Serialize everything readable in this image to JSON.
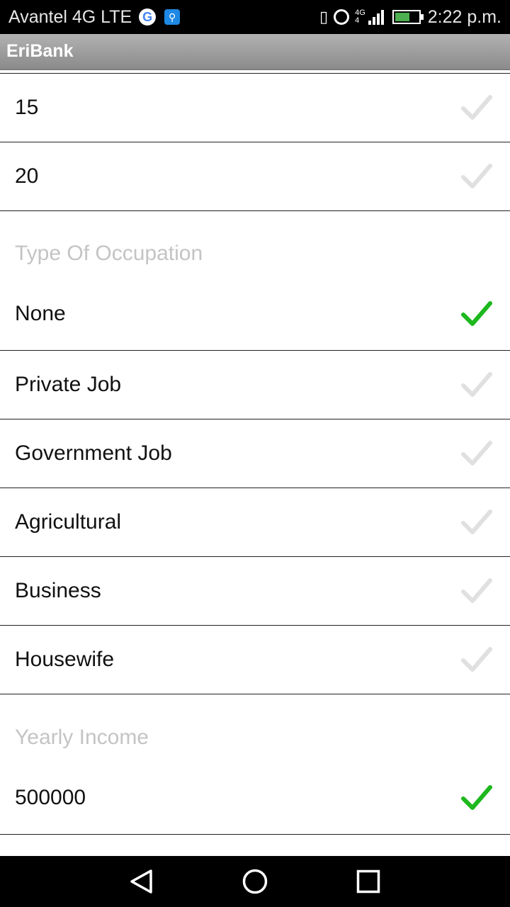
{
  "status_bar": {
    "carrier": "Avantel 4G LTE",
    "network_label_top": "4G",
    "network_label_bottom": "4",
    "time": "2:22 p.m.",
    "battery_level": 0.62
  },
  "app_bar": {
    "title": "EriBank"
  },
  "colors": {
    "check_selected": "#1db81d",
    "check_unselected": "#e0e0e0",
    "section_header": "#c4c4c4"
  },
  "lists": {
    "top_rows": [
      {
        "label": "15",
        "selected": false
      },
      {
        "label": "20",
        "selected": false
      }
    ],
    "occupation": {
      "header": "Type Of Occupation",
      "options": [
        {
          "label": "None",
          "selected": true
        },
        {
          "label": "Private Job",
          "selected": false
        },
        {
          "label": "Government Job",
          "selected": false
        },
        {
          "label": "Agricultural",
          "selected": false
        },
        {
          "label": "Business",
          "selected": false
        },
        {
          "label": "Housewife",
          "selected": false
        }
      ]
    },
    "income": {
      "header": "Yearly Income",
      "options": [
        {
          "label": "500000",
          "selected": true
        }
      ]
    }
  },
  "nav_bar": {
    "icons": [
      "back-triangle-icon",
      "home-circle-icon",
      "recents-square-icon"
    ]
  }
}
